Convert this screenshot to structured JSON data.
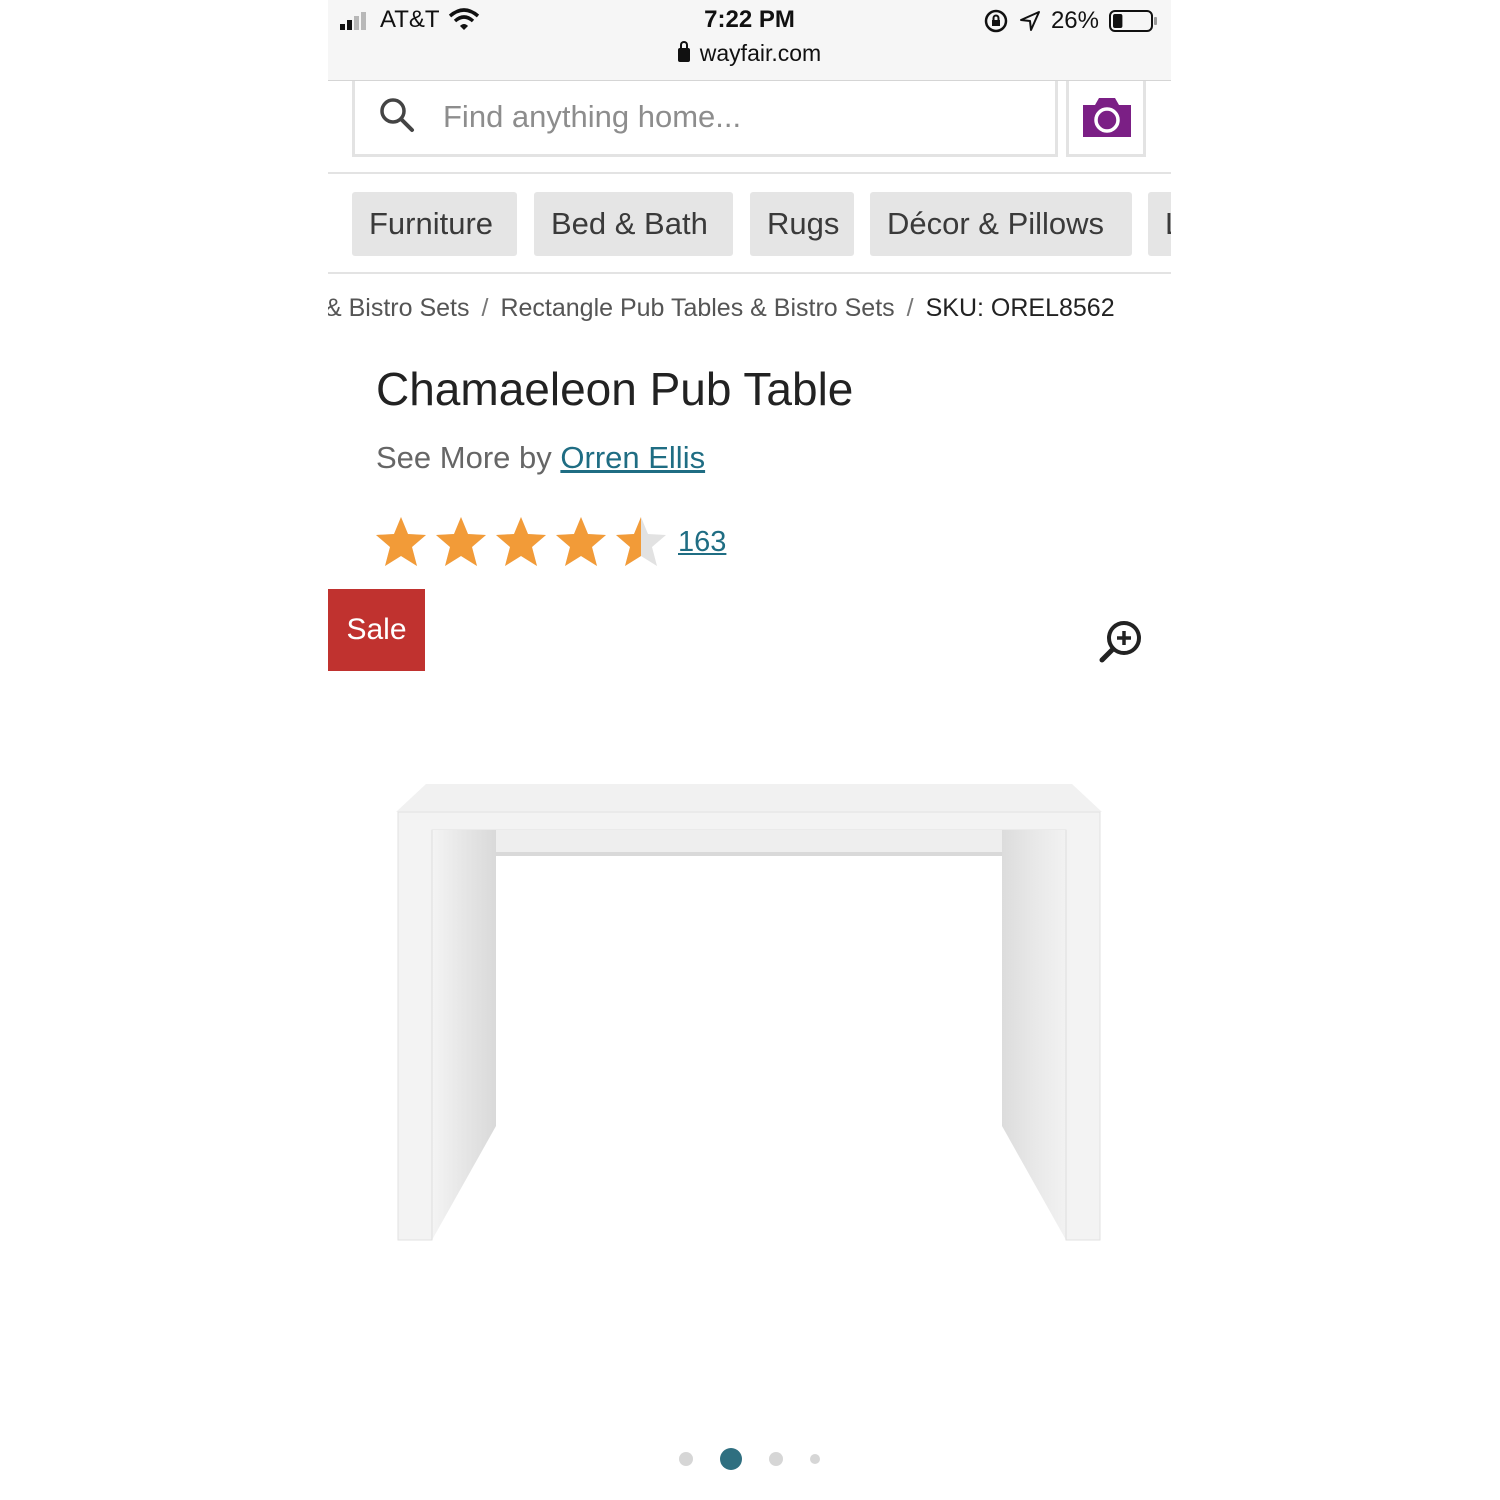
{
  "status_bar": {
    "carrier": "AT&T",
    "time": "7:22 PM",
    "battery": "26%",
    "battery_level": 0.26,
    "url": "wayfair.com"
  },
  "search": {
    "placeholder": "Find anything home...",
    "value": ""
  },
  "nav": {
    "items": [
      "Furniture",
      "Bed & Bath",
      "Rugs",
      "Décor & Pillows",
      "L"
    ]
  },
  "breadcrumb": {
    "items": [
      "& Bistro Sets",
      "Rectangle Pub Tables & Bistro Sets"
    ],
    "separator": "/",
    "sku": "SKU: OREL8562"
  },
  "product": {
    "title": "Chamaeleon Pub Table",
    "see_more_prefix": "See More by",
    "brand": "Orren Ellis",
    "rating": 4.5,
    "rating_max": 5,
    "review_count": "163",
    "sale_badge": "Sale"
  },
  "gallery": {
    "dot_count": 4,
    "active_index": 1
  },
  "colors": {
    "brand_purple": "#7b1f85",
    "link_teal": "#1f6d83",
    "star_orange": "#f29b38",
    "sale_red": "#c0322f"
  },
  "icons": [
    "signal-icon",
    "wifi-icon",
    "rotation-lock-icon",
    "location-arrow-icon",
    "battery-icon",
    "lock-icon",
    "search-icon",
    "camera-icon",
    "star-icon",
    "zoom-in-icon"
  ]
}
